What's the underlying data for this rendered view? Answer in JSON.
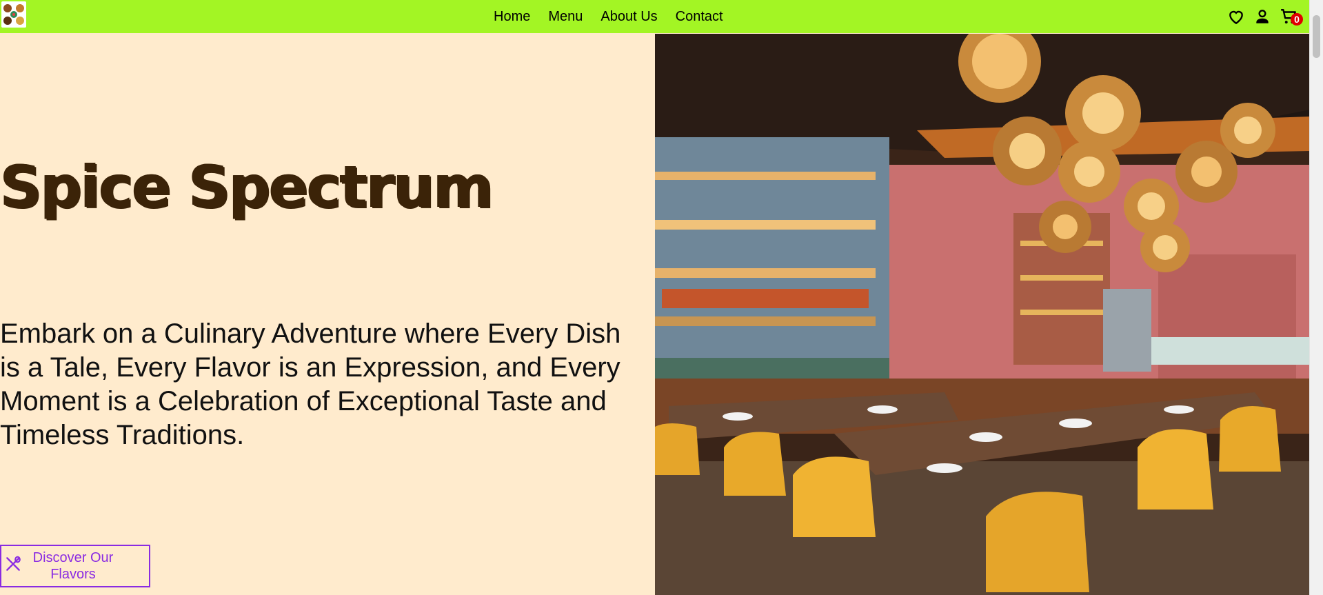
{
  "nav": {
    "logo_icon": "restaurant-logo-icon",
    "links": [
      "Home",
      "Menu",
      "About Us",
      "Contact"
    ],
    "icons": [
      "heart-icon",
      "user-icon",
      "cart-icon"
    ],
    "cart_count": "0",
    "colors": {
      "background": "#a3f524",
      "badge": "#e00000"
    }
  },
  "hero": {
    "title": "Spice Spectrum",
    "tagline": "Embark on a Culinary Adventure where Every Dish is a Tale, Every Flavor is an Expression, and Every Moment is a Celebration of Exceptional Taste and Timeless Traditions.",
    "cta_label": "Discover Our Flavors",
    "cta_icon": "fork-spoon-icon",
    "image": "restaurant-interior-photo",
    "colors": {
      "background": "#ffebcd",
      "title": "#3b2308",
      "cta": "#8a2be2"
    }
  }
}
